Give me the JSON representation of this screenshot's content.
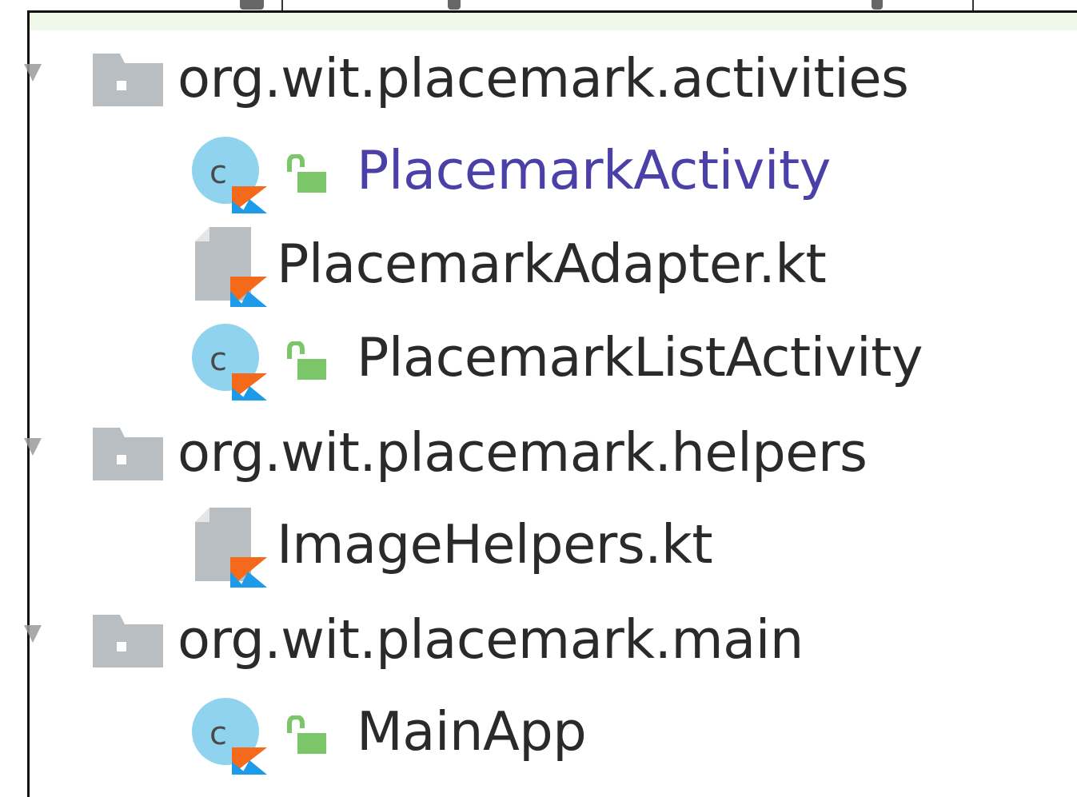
{
  "tree": {
    "packages": [
      {
        "name": "org.wit.placemark.activities",
        "children": [
          {
            "name": "PlacemarkActivity",
            "kind": "class",
            "highlighted": true
          },
          {
            "name": "PlacemarkAdapter.kt",
            "kind": "file",
            "highlighted": false
          },
          {
            "name": "PlacemarkListActivity",
            "kind": "class",
            "highlighted": false
          }
        ]
      },
      {
        "name": "org.wit.placemark.helpers",
        "children": [
          {
            "name": "ImageHelpers.kt",
            "kind": "file",
            "highlighted": false
          }
        ]
      },
      {
        "name": "org.wit.placemark.main",
        "children": [
          {
            "name": "MainApp",
            "kind": "class",
            "highlighted": false
          }
        ]
      }
    ]
  },
  "icons": {
    "package": "folder-icon",
    "class": "kotlin-class-icon",
    "file": "kotlin-file-icon",
    "access": "open-lock-icon",
    "expand": "expand-arrow-icon"
  },
  "colors": {
    "text": "#2a2a2a",
    "highlight_text": "#4b3fa8",
    "folder": "#b9bec3",
    "class_circle": "#8fd3ef",
    "kotlin_orange": "#f46a1a",
    "kotlin_blue": "#1e9be8",
    "lock_green": "#7cc66a"
  }
}
